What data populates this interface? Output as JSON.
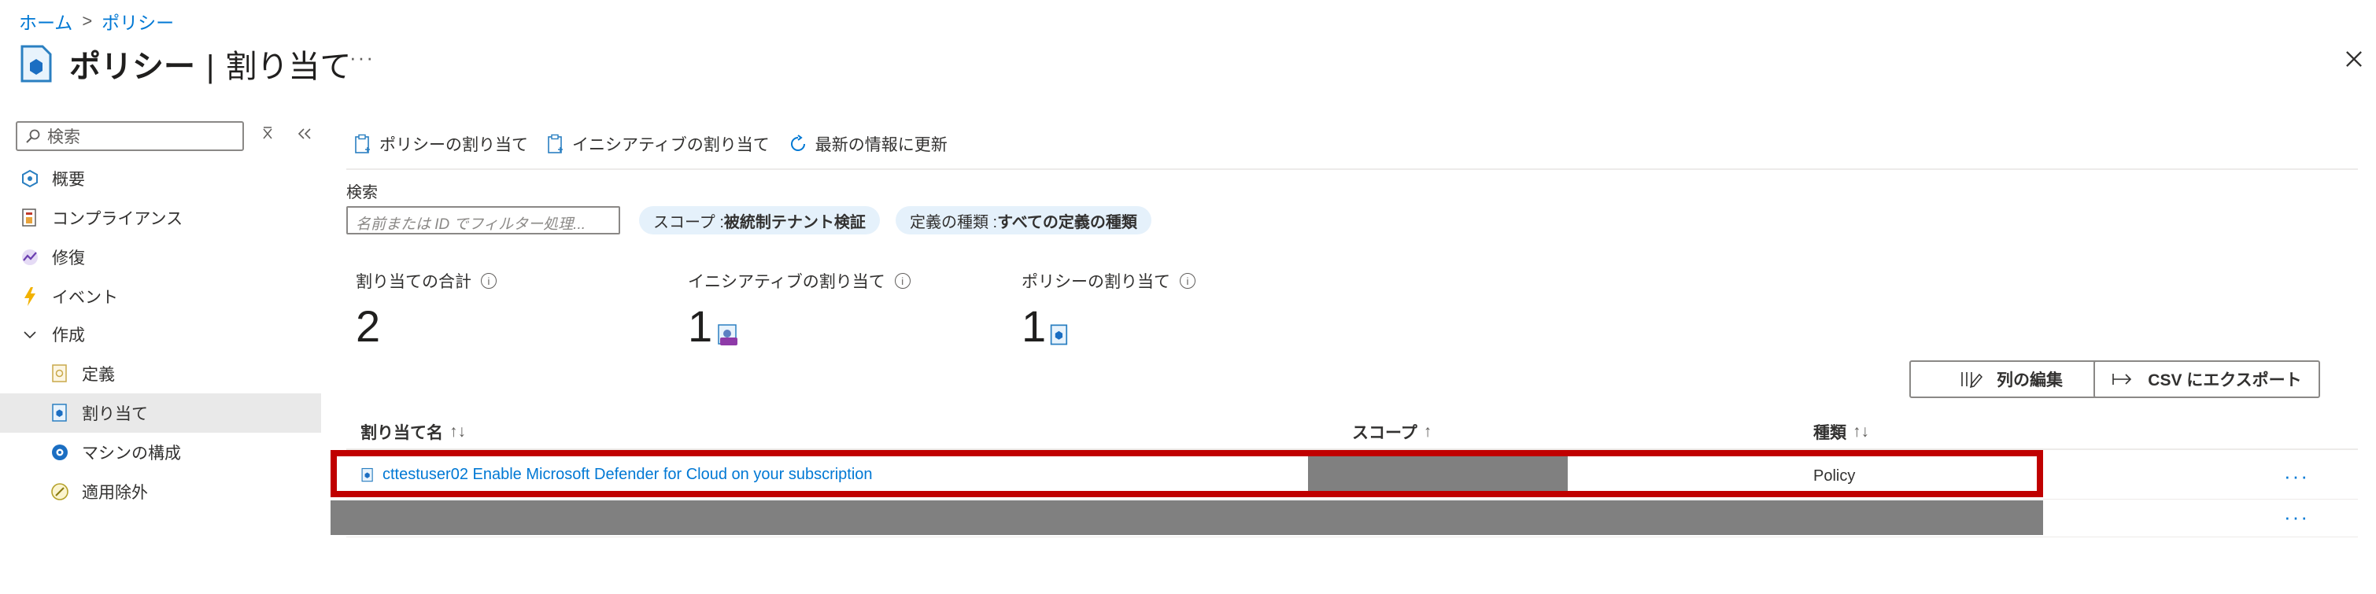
{
  "breadcrumb": {
    "home": "ホーム",
    "separator": ">",
    "current": "ポリシー"
  },
  "header": {
    "title": "ポリシー",
    "separator": "|",
    "subtitle": "割り当て",
    "more": "···"
  },
  "sidebar": {
    "search_placeholder": "検索",
    "items": [
      {
        "label": "概要",
        "icon": "overview-icon"
      },
      {
        "label": "コンプライアンス",
        "icon": "compliance-icon"
      },
      {
        "label": "修復",
        "icon": "remediation-icon"
      },
      {
        "label": "イベント",
        "icon": "lightning-icon"
      },
      {
        "label": "作成",
        "icon": "chevron-down-icon"
      },
      {
        "label": "定義",
        "icon": "definition-icon"
      },
      {
        "label": "割り当て",
        "icon": "assignment-icon",
        "selected": true
      },
      {
        "label": "マシンの構成",
        "icon": "machine-config-icon"
      },
      {
        "label": "適用除外",
        "icon": "exemption-icon"
      }
    ]
  },
  "toolbar": {
    "assign_policy": "ポリシーの割り当て",
    "assign_initiative": "イニシアティブの割り当て",
    "refresh": "最新の情報に更新"
  },
  "filter": {
    "label": "検索",
    "placeholder": "名前または ID でフィルター処理...",
    "scope_key": "スコープ : ",
    "scope_value": "被統制テナント検証",
    "deftype_key": "定義の種類 : ",
    "deftype_value": "すべての定義の種類"
  },
  "stats": [
    {
      "label": "割り当ての合計",
      "value": "2"
    },
    {
      "label": "イニシアティブの割り当て",
      "value": "1"
    },
    {
      "label": "ポリシーの割り当て",
      "value": "1"
    }
  ],
  "actions": {
    "edit_columns": "列の編集",
    "export_csv": "CSV にエクスポート"
  },
  "table": {
    "columns": [
      {
        "label": "割り当て名",
        "sort": "↑↓"
      },
      {
        "label": "スコープ",
        "sort": "↑"
      },
      {
        "label": "種類",
        "sort": "↑↓"
      }
    ],
    "rows": [
      {
        "name": "cttestuser02 Enable Microsoft Defender for Cloud on your subscription",
        "scope": "",
        "type": "Policy",
        "more": "···"
      },
      {
        "name": "",
        "scope": "",
        "type": "",
        "more": "···"
      }
    ]
  },
  "colors": {
    "accent": "#0078d4",
    "highlight_border": "#c00000",
    "redaction": "#808080"
  }
}
